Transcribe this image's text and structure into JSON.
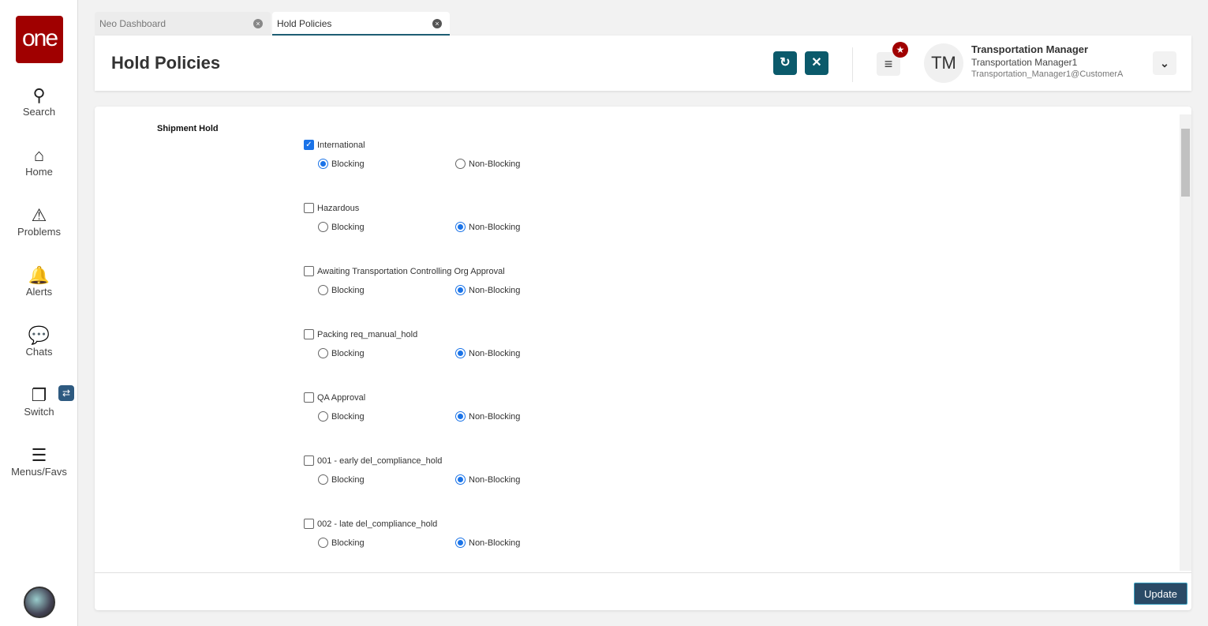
{
  "sidebar": {
    "logo": "one",
    "items": [
      {
        "label": "Search",
        "icon": "search-icon"
      },
      {
        "label": "Home",
        "icon": "home-icon"
      },
      {
        "label": "Problems",
        "icon": "warning-icon"
      },
      {
        "label": "Alerts",
        "icon": "bell-icon"
      },
      {
        "label": "Chats",
        "icon": "chat-icon"
      },
      {
        "label": "Switch",
        "icon": "switch-icon"
      },
      {
        "label": "Menus/Favs",
        "icon": "menu-icon"
      }
    ]
  },
  "tabs": [
    {
      "label": "Neo Dashboard",
      "active": false
    },
    {
      "label": "Hold Policies",
      "active": true
    }
  ],
  "header": {
    "title": "Hold Policies",
    "user": {
      "initials": "TM",
      "role": "Transportation Manager",
      "name": "Transportation Manager1",
      "account": "Transportation_Manager1@CustomerA"
    }
  },
  "section": "Shipment Hold",
  "options": {
    "blocking": "Blocking",
    "non_blocking": "Non-Blocking"
  },
  "holds": [
    {
      "label": "International",
      "checked": true,
      "mode": "Blocking"
    },
    {
      "label": "Hazardous",
      "checked": false,
      "mode": "Non-Blocking"
    },
    {
      "label": "Awaiting Transportation Controlling Org Approval",
      "checked": false,
      "mode": "Non-Blocking"
    },
    {
      "label": "Packing req_manual_hold",
      "checked": false,
      "mode": "Non-Blocking"
    },
    {
      "label": "QA Approval",
      "checked": false,
      "mode": "Non-Blocking"
    },
    {
      "label": "001 - early del_compliance_hold",
      "checked": false,
      "mode": "Non-Blocking"
    },
    {
      "label": "002 - late del_compliance_hold",
      "checked": false,
      "mode": "Non-Blocking"
    }
  ],
  "footer": {
    "update_label": "Update"
  }
}
